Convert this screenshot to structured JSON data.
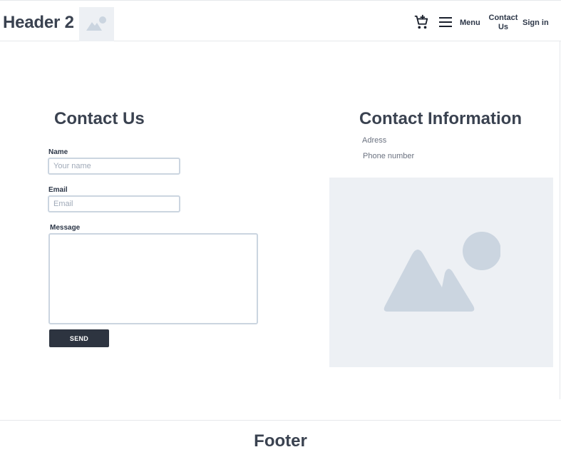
{
  "header": {
    "brand": "Header 2",
    "logo_icon": "image-placeholder-icon",
    "cart_icon": "cart-add-icon",
    "menu_icon": "hamburger-icon",
    "nav": {
      "menu": "Menu",
      "contact": "Contact Us",
      "signin": "Sign in"
    }
  },
  "contact_form": {
    "title": "Contact Us",
    "name_label": "Name",
    "name_placeholder": "Your name",
    "email_label": "Email",
    "email_placeholder": "Email",
    "message_label": "Message",
    "send_label": "SEND"
  },
  "contact_info": {
    "title": "Contact Information",
    "address": "Adress",
    "phone": "Phone number",
    "map_icon": "image-placeholder-icon"
  },
  "footer": {
    "title": "Footer"
  },
  "colors": {
    "heading": "#3a4250",
    "button_bg": "#2d3440",
    "placeholder_bg": "#edf0f4",
    "placeholder_shape": "#cbd5e0",
    "border": "#cbd5e0"
  }
}
